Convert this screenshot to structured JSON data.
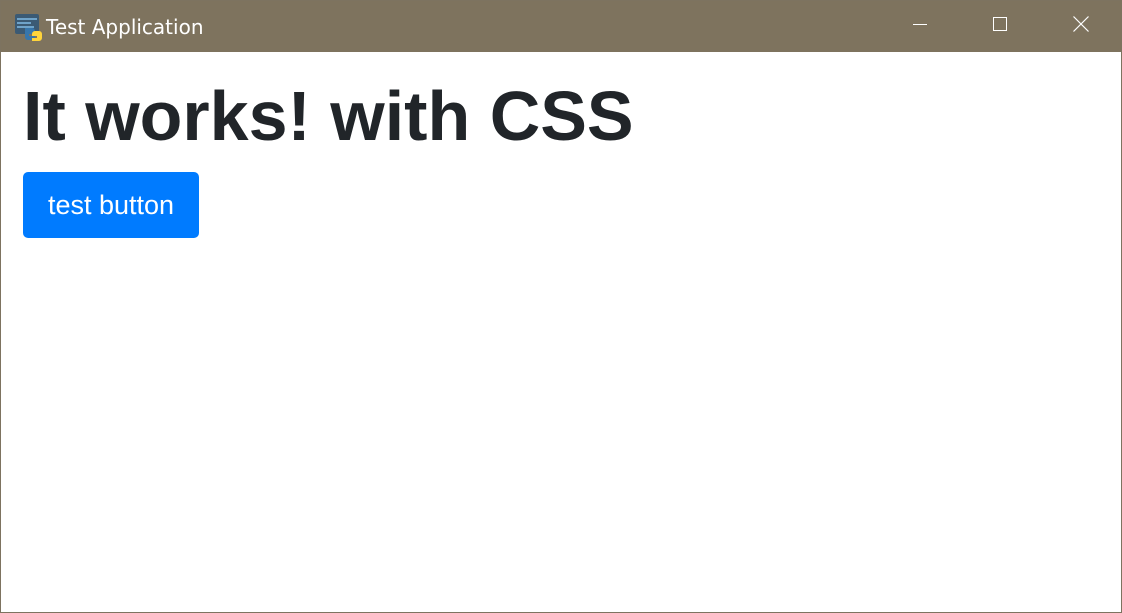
{
  "window": {
    "title": "Test Application",
    "controls": {
      "minimize": "minimize-icon",
      "maximize": "maximize-icon",
      "close": "close-icon"
    },
    "app_icon": "python-icon",
    "titlebar_color": "#7e735e"
  },
  "main": {
    "heading": "It works! with CSS",
    "button_label": "test button",
    "button_color": "#007bff",
    "heading_color": "#212529"
  }
}
